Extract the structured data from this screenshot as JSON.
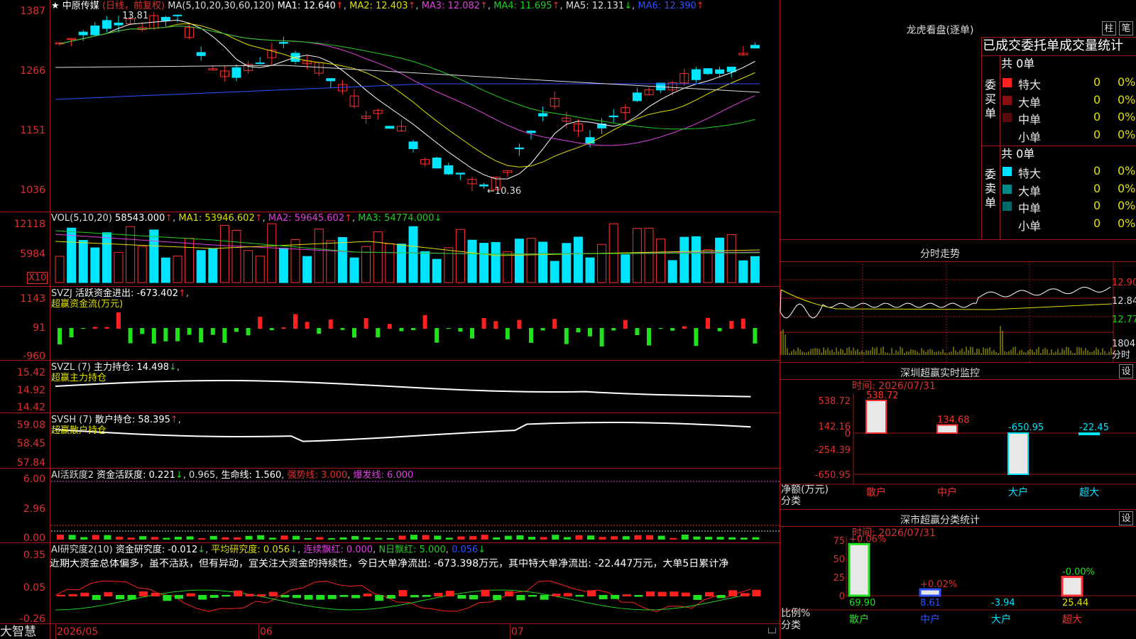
{
  "stock": {
    "star": "★",
    "name": "中原传媒",
    "period": "(日线，前复权)",
    "ma_prefix": "MA(5,10,20,30,60,120)",
    "ma1": "MA1: 12.640",
    "ma2": "MA2: 12.403",
    "ma3": "MA3: 12.082",
    "ma4": "MA4: 11.695",
    "ma5": "MA5: 12.131",
    "ma6": "MA6: 12.390",
    "high_note": "13.81",
    "low_note": "←10.36",
    "y_labels": [
      "1387",
      "1266",
      "1151",
      "1036"
    ]
  },
  "vol": {
    "title": "VOL(5,10,20)",
    "value": "58543.000",
    "ma1": "MA1: 53946.602",
    "ma2": "MA2: 59645.602",
    "ma3": "MA3: 54774.000",
    "y_labels": [
      "12118",
      "5984"
    ],
    "unit": "X10"
  },
  "svzj": {
    "title": "SVZJ",
    "label": "活跃资金进出: -673.402",
    "sub": "超赢资金流(万元)",
    "y_labels": [
      "1143",
      "91",
      "-960"
    ]
  },
  "svzl": {
    "title": "SVZL (7)",
    "label": "主力持仓: 14.498",
    "sub": "超赢主力持仓",
    "y_labels": [
      "15.42",
      "14.92",
      "14.42"
    ]
  },
  "svsh": {
    "title": "SVSH (7)",
    "label": "散户持仓: 58.395",
    "sub": "超赢散户持仓",
    "y_labels": [
      "59.08",
      "58.45",
      "57.84"
    ]
  },
  "ai1": {
    "title": "AI活跃度2",
    "label": "资金活跃度: 0.221",
    "v2": "0.965",
    "v3": "生命线: 1.560",
    "v4": "强势线: 3.000",
    "v5": "爆发线: 6.000",
    "y_labels": [
      "6.00",
      "2.96",
      "0.00"
    ]
  },
  "ai2": {
    "title": "AI研究度2(10)",
    "label": "资金研究度: -0.012",
    "v2": "平均研究度: 0.056",
    "v3": "连续飘红: 0.000",
    "v4": "N日飘红: 5.000",
    "v5": "0.056",
    "comment": "近期大资金总体偏多，虽不活跃，但有异动，宜关注大资金的持续性，今日大单净流出: -673.398万元，其中特大单净流出: -22.447万元，大单5日累计净",
    "y_labels": [
      "0.35",
      "0.05",
      "-0.26"
    ]
  },
  "bottom": {
    "brand": "大智慧",
    "date1": "2026/05",
    "date2": "06",
    "date3": "07"
  },
  "lhb": {
    "title": "龙虎看盘(逐单)",
    "btn1": "柱",
    "btn2": "笔",
    "header": "已成交委托单成交量统计",
    "buy_total": "共 0单",
    "sell_total": "共 0单",
    "buy_label": [
      "委",
      "买",
      "单"
    ],
    "sell_label": [
      "委",
      "卖",
      "单"
    ],
    "buy_rows": [
      {
        "name": "特大",
        "count": "0",
        "pct": "0%",
        "color": "#ff2020"
      },
      {
        "name": "大单",
        "count": "0",
        "pct": "0%",
        "color": "#8a1010"
      },
      {
        "name": "中单",
        "count": "0",
        "pct": "0%",
        "color": "#5a0a0a"
      },
      {
        "name": "小单",
        "count": "0",
        "pct": "0%",
        "color": "#000000"
      }
    ],
    "sell_rows": [
      {
        "name": "特大",
        "count": "0",
        "pct": "0%",
        "color": "#00e0ff"
      },
      {
        "name": "大单",
        "count": "0",
        "pct": "0%",
        "color": "#008a8a"
      },
      {
        "name": "中单",
        "count": "0",
        "pct": "0%",
        "color": "#006a6a"
      },
      {
        "name": "小单",
        "count": "0",
        "pct": "0%",
        "color": "#000000"
      }
    ]
  },
  "intraday": {
    "title": "分时走势",
    "prices": [
      "12.90",
      "12.84",
      "12.77"
    ],
    "vol": "1804",
    "vol_unit": "分时"
  },
  "monitor": {
    "title": "深圳超赢实时监控",
    "btn": "设",
    "time": "时间: 2026/07/31",
    "y_labels": [
      "538.72",
      "142.16",
      "0",
      "-254.39",
      "-650.95"
    ],
    "unit": "净额(万元)",
    "unit2": "分类",
    "bars": [
      {
        "cat": "散户",
        "value": 538.72,
        "label": "538.72"
      },
      {
        "cat": "中户",
        "value": 134.68,
        "label": "134.68"
      },
      {
        "cat": "大户",
        "value": -650.95,
        "label": "-650.95"
      },
      {
        "cat": "超大",
        "value": -22.45,
        "label": "-22.45"
      }
    ]
  },
  "classify": {
    "title": "深市超赢分类统计",
    "btn": "设",
    "time": "时间: 2026/07/31",
    "y_labels": [
      "75",
      "50",
      "25",
      "0"
    ],
    "unit": "比例%",
    "unit2": "分类",
    "bars": [
      {
        "cat": "散户",
        "value": 69.9,
        "label": "69.90",
        "delta": "+0.06%"
      },
      {
        "cat": "中户",
        "value": 8.61,
        "label": "8.61",
        "delta": "+0.02%"
      },
      {
        "cat": "大户",
        "value": -3.94,
        "label": "-3.94",
        "delta": ""
      },
      {
        "cat": "超大",
        "value": 25.44,
        "label": "25.44",
        "delta": "-0.00%"
      }
    ]
  }
}
